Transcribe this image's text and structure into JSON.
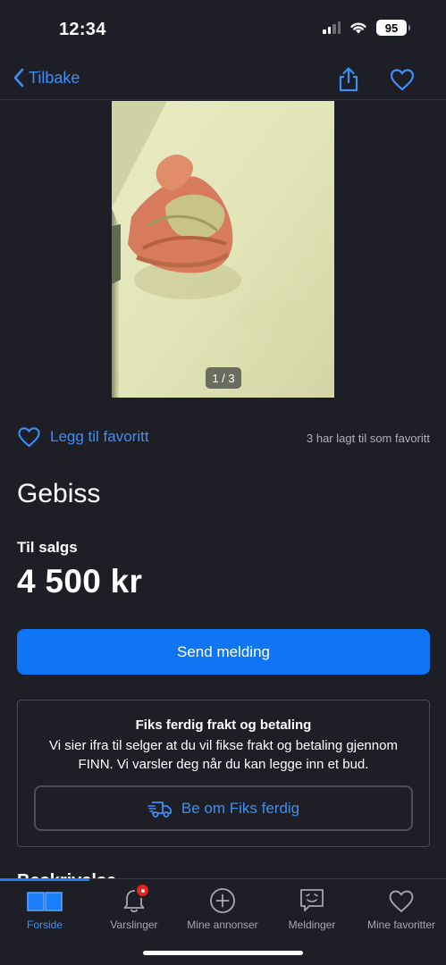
{
  "status_bar": {
    "time": "12:34",
    "battery": "95"
  },
  "nav": {
    "back_label": "Tilbake"
  },
  "listing": {
    "image_counter": "1 / 3",
    "favorite_label": "Legg til favoritt",
    "favorite_count_text": "3 har lagt til som favoritt",
    "title": "Gebiss",
    "sale_type": "Til salgs",
    "price": "4 500 kr"
  },
  "actions": {
    "send_message": "Send melding"
  },
  "fiks_ferdig": {
    "title": "Fiks ferdig frakt og betaling",
    "description": "Vi sier ifra til selger at du vil fikse frakt og betaling gjennom FINN. Vi varsler deg når du kan legge inn et bud.",
    "button_label": "Be om Fiks ferdig"
  },
  "peek_section_title": "Beskrivelse",
  "tab_bar": {
    "tabs": [
      {
        "label": "Forside",
        "icon": "book-icon",
        "active": true
      },
      {
        "label": "Varslinger",
        "icon": "bell-icon",
        "badge": true
      },
      {
        "label": "Mine annonser",
        "icon": "plus-circle-icon"
      },
      {
        "label": "Meldinger",
        "icon": "message-icon"
      },
      {
        "label": "Mine favoritter",
        "icon": "heart-icon"
      }
    ]
  },
  "colors": {
    "accent": "#3d8ff5",
    "primary_button": "#0f75f5",
    "background": "#1e1e26",
    "badge": "#e5221b"
  }
}
